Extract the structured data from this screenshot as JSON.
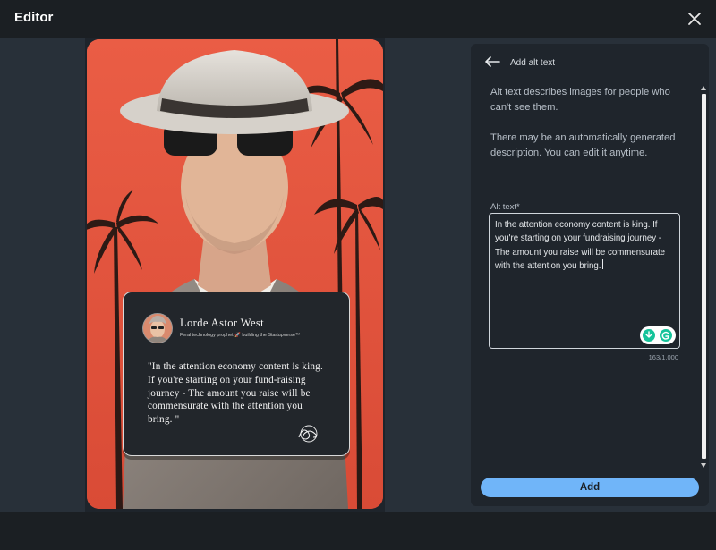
{
  "window": {
    "title": "Editor"
  },
  "image": {
    "quote_card": {
      "name": "Lorde Astor West",
      "tagline": "Feral technology prophet 🚀 building the Startupverse™",
      "quote": "\"In the attention economy content is king. If you're starting on your fund-raising journey - The amount you raise will be commensurate with the attention you bring. \""
    }
  },
  "panel": {
    "title": "Add alt text",
    "description_1": "Alt text describes images for people who can't see them.",
    "description_2": "There may be an automatically generated description. You can edit it anytime.",
    "field_label": "Alt text*",
    "alt_text_value": "In the attention economy content is king. If you're starting on your fundraising journey - The amount you raise will be commensurate with the attention you bring.",
    "counter": "163/1,000",
    "add_label": "Add"
  },
  "colors": {
    "accent": "#70b5f9",
    "background": "#1b1f23",
    "panel": "#1f252c",
    "image_bg": "#e2563f"
  },
  "icons": [
    "close-icon",
    "back-arrow-icon",
    "grammarly-icon",
    "assistant-icon"
  ]
}
